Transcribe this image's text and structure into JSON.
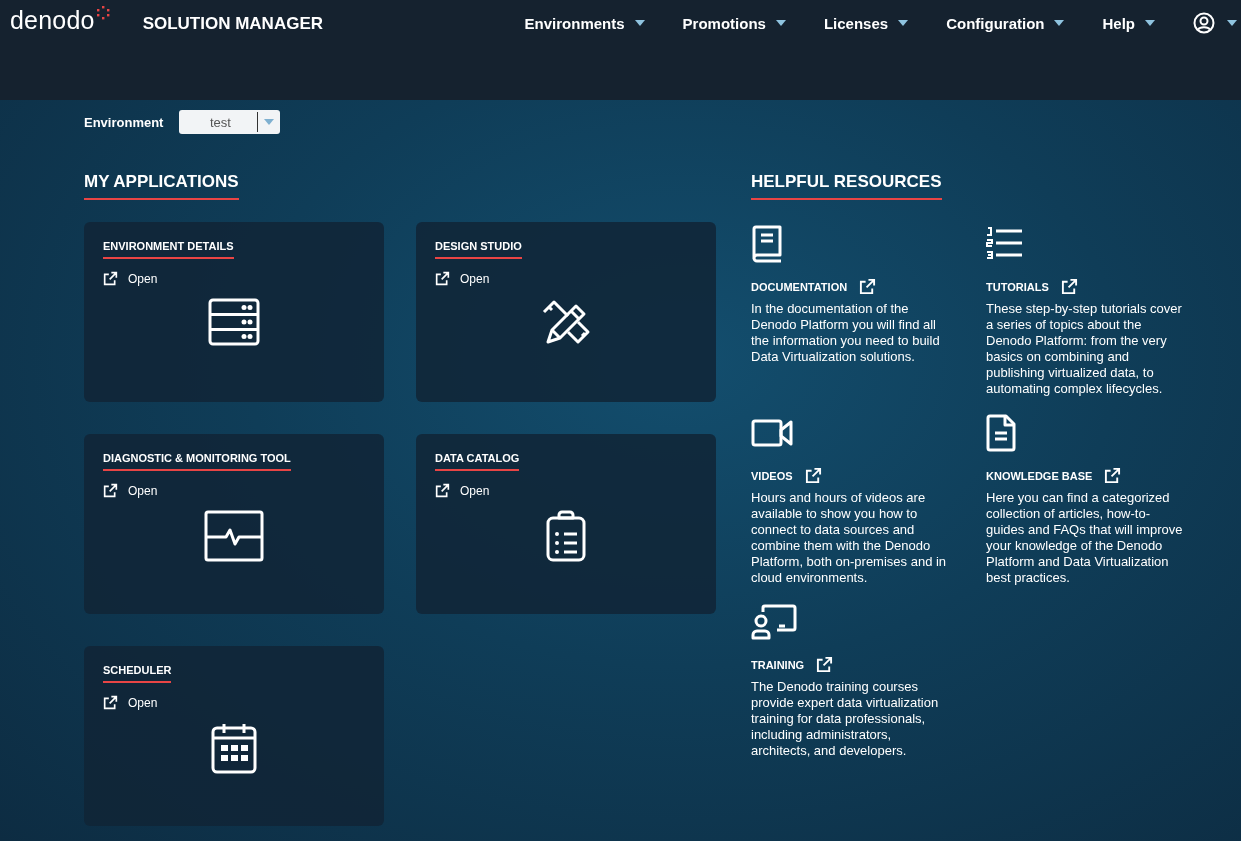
{
  "header": {
    "logo": "denodo",
    "title": "SOLUTION MANAGER",
    "nav": [
      {
        "label": "Environments"
      },
      {
        "label": "Promotions"
      },
      {
        "label": "Licenses"
      },
      {
        "label": "Configuration"
      },
      {
        "label": "Help"
      }
    ]
  },
  "environment": {
    "label": "Environment",
    "value": "test"
  },
  "applications": {
    "heading": "MY APPLICATIONS",
    "items": [
      {
        "title": "ENVIRONMENT DETAILS",
        "action": "Open",
        "kind": "server"
      },
      {
        "title": "DESIGN STUDIO",
        "action": "Open",
        "kind": "tools"
      },
      {
        "title": "DIAGNOSTIC & MONITORING TOOL",
        "action": "Open",
        "kind": "monitor"
      },
      {
        "title": "DATA CATALOG",
        "action": "Open",
        "kind": "clipboard"
      },
      {
        "title": "SCHEDULER",
        "action": "Open",
        "kind": "calendar"
      }
    ]
  },
  "resources": {
    "heading": "HELPFUL RESOURCES",
    "items": [
      {
        "title": "DOCUMENTATION",
        "kind": "book",
        "description": "In the documentation of the Denodo Platform you will find all the information you need to build Data Virtualization solutions."
      },
      {
        "title": "TUTORIALS",
        "kind": "list",
        "description": "These step-by-step tutorials cover a series of topics about the Denodo Platform: from the very basics on combining and publishing virtualized data, to automating complex lifecycles."
      },
      {
        "title": "VIDEOS",
        "kind": "video",
        "description": "Hours and hours of videos are available to show you how to connect to data sources and combine them with the Denodo Platform, both on-premises and in cloud environments."
      },
      {
        "title": "KNOWLEDGE BASE",
        "kind": "document",
        "description": "Here you can find a categorized collection of articles, how-to-guides and FAQs that will improve your knowledge of the Denodo Platform and Data Virtualization best practices."
      },
      {
        "title": "TRAINING",
        "kind": "training",
        "description": "The Denodo training courses provide expert data virtualization training for data professionals, including administrators, architects, and developers."
      }
    ]
  }
}
